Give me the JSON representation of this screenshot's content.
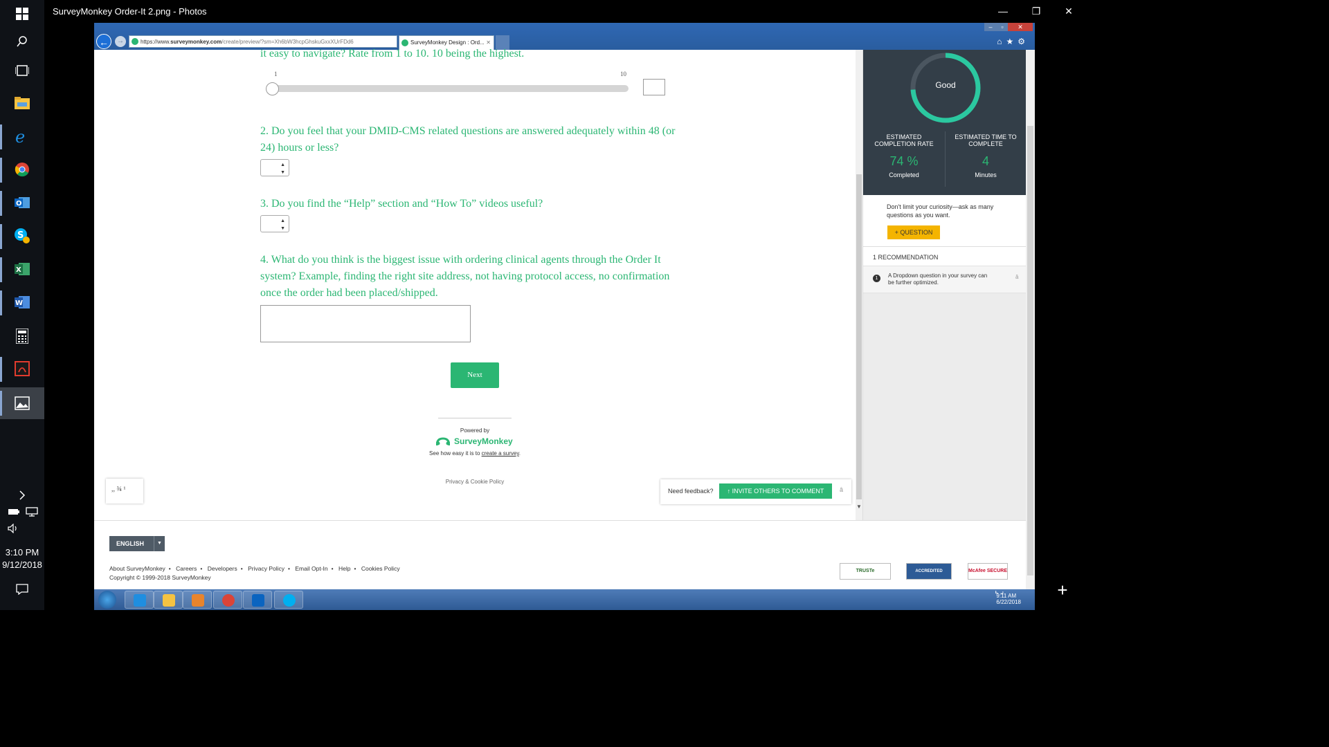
{
  "window": {
    "title": "SurveyMonkey Order-It 2.png - Photos",
    "minimize": "—",
    "restore": "❐",
    "close": "✕"
  },
  "taskbar": {
    "time": "3:10 PM",
    "date": "9/12/2018"
  },
  "browser": {
    "url_prefix": "https://www.",
    "url_domain": "surveymonkey.com",
    "url_rest": "/create/preview/?sm=Xh6bW3hcpGhskuGxxXUrFDd6",
    "tab_title": "SurveyMonkey Design : Ord...",
    "tab_close": "✕"
  },
  "survey": {
    "q1_partial": "it easy to navigate? Rate from 1 to 10. 10 being the highest.",
    "slider_min": "1",
    "slider_max": "10",
    "q2": "2. Do you feel that your DMID-CMS related questions are answered adequately within 48 (or 24) hours or less?",
    "q3": "3. Do you find the “Help” section and “How To” videos useful?",
    "q4": "4. What do you think is the biggest issue with ordering clinical agents through the Order It system? Example, finding the right site address, not having protocol access, no confirmation once the order had been placed/shipped.",
    "next": "Next",
    "powered_by": "Powered by",
    "brand": "SurveyMonkey",
    "see_how_prefix": "See how easy it is to ",
    "see_how_link": "create a survey",
    "see_how_suffix": ".",
    "privacy": "Privacy & Cookie Policy",
    "a11y_text": ",, ¾ ¹"
  },
  "feedback": {
    "label": "Need feedback?",
    "button": "↑  INVITE OTHERS TO COMMENT",
    "close": "â"
  },
  "panel": {
    "gauge_label": "Good",
    "gauge_fraction": 0.74,
    "rate_head": "ESTIMATED COMPLETION RATE",
    "rate_value": "74 %",
    "rate_sub": "Completed",
    "time_head": "ESTIMATED TIME TO COMPLETE",
    "time_value": "4",
    "time_sub": "Minutes",
    "tip": "Don't limit your curiosity—ask as many questions as you want.",
    "question_button": "+  QUESTION",
    "rec_head": "1 RECOMMENDATION",
    "rec_num": "1",
    "rec_text": "A Dropdown question in your survey can be further optimized.",
    "rec_close": "â"
  },
  "footer": {
    "language": "ENGLISH",
    "links": [
      "About SurveyMonkey",
      "Careers",
      "Developers",
      "Privacy Policy",
      "Email Opt-In",
      "Help",
      "Cookies Policy"
    ],
    "copyright": "Copyright © 1999-2018 SurveyMonkey",
    "badge_truste": "TRUSTe",
    "badge_bbb": "ACCREDITED BUSINESS",
    "badge_mcafee": "McAfee SECURE"
  },
  "w7": {
    "time": "9:11 AM",
    "date": "6/22/2018"
  },
  "colors": {
    "accent": "#2bb673",
    "panel_dark": "#333e48",
    "question_button": "#f4b400"
  }
}
